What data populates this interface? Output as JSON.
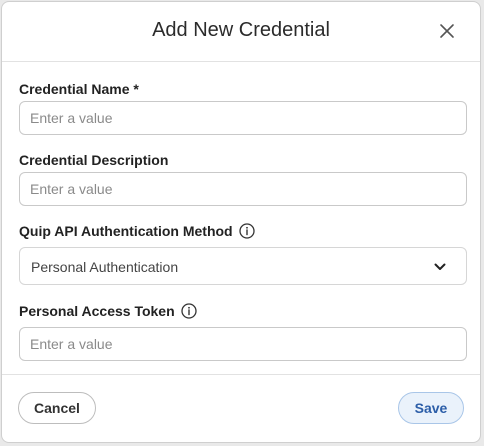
{
  "dialog": {
    "title": "Add New Credential"
  },
  "fields": {
    "name": {
      "label": "Credential Name *",
      "placeholder": "Enter a value",
      "value": ""
    },
    "description": {
      "label": "Credential Description",
      "placeholder": "Enter a value",
      "value": ""
    },
    "auth_method": {
      "label": "Quip API Authentication Method",
      "selected": "Personal Authentication"
    },
    "token": {
      "label": "Personal Access Token",
      "placeholder": "Enter a value",
      "value": ""
    }
  },
  "footer": {
    "cancel_label": "Cancel",
    "save_label": "Save"
  },
  "colors": {
    "save_bg": "#eaf2fb",
    "save_text": "#2c5ea8",
    "border": "#c9c9c9"
  },
  "icons": [
    "close-icon",
    "info-icon",
    "chevron-down-icon"
  ]
}
